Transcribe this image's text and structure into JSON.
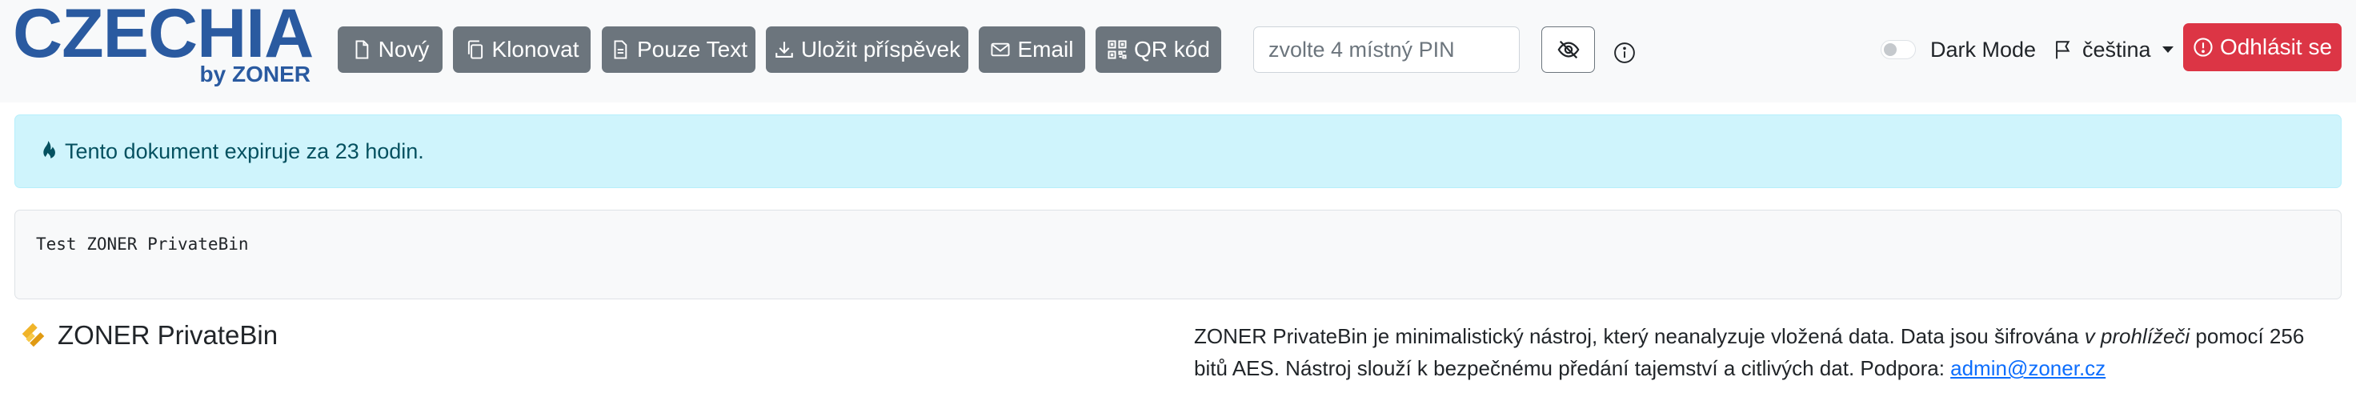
{
  "logo": {
    "main": "CZECHIA",
    "sub": "by ZONER"
  },
  "toolbar": {
    "new_label": "Nový",
    "clone_label": "Klonovat",
    "raw_label": "Pouze Text",
    "save_label": "Uložit příspěvek",
    "email_label": "Email",
    "qr_label": "QR kód"
  },
  "pin": {
    "placeholder": "zvolte 4 místný PIN",
    "value": ""
  },
  "dark_mode": {
    "label": "Dark Mode",
    "enabled": false
  },
  "language": {
    "selected": "čeština"
  },
  "logout_label": "Odhlásit se",
  "alert": {
    "text": "Tento dokument expiruje za 23 hodin."
  },
  "paste": {
    "content": "Test ZONER PrivateBin"
  },
  "footer": {
    "brand": "ZONER PrivateBin",
    "desc_pre": "ZONER PrivateBin je minimalistický nástroj, který neanalyzuje vložená data. Data jsou šifrována ",
    "desc_em": "v prohlížeči",
    "desc_post": " pomocí 256 bitů AES. Nástroj slouží k bezpečnému předání tajemství a citlivých dat. Podpora: ",
    "support_email": "admin@zoner.cz"
  },
  "colors": {
    "brand": "#2a5aa0",
    "secondary": "#6c757d",
    "danger": "#dc3545",
    "info_bg": "#cff4fc",
    "info_text": "#055160",
    "navbar_bg": "#f8f9fa",
    "link": "#0d6efd",
    "footer_icon": "#f0b429"
  },
  "icons": {
    "new": "file-icon",
    "clone": "copy-icon",
    "raw": "file-text-icon",
    "save": "download-icon",
    "email": "envelope-icon",
    "qr": "qr-code-icon",
    "pin_toggle": "eye-slash-icon",
    "info": "info-circle-icon",
    "language": "flag-icon",
    "logout": "exclamation-circle-icon",
    "alert": "fire-icon",
    "brand": "privatebin-logo-icon"
  }
}
